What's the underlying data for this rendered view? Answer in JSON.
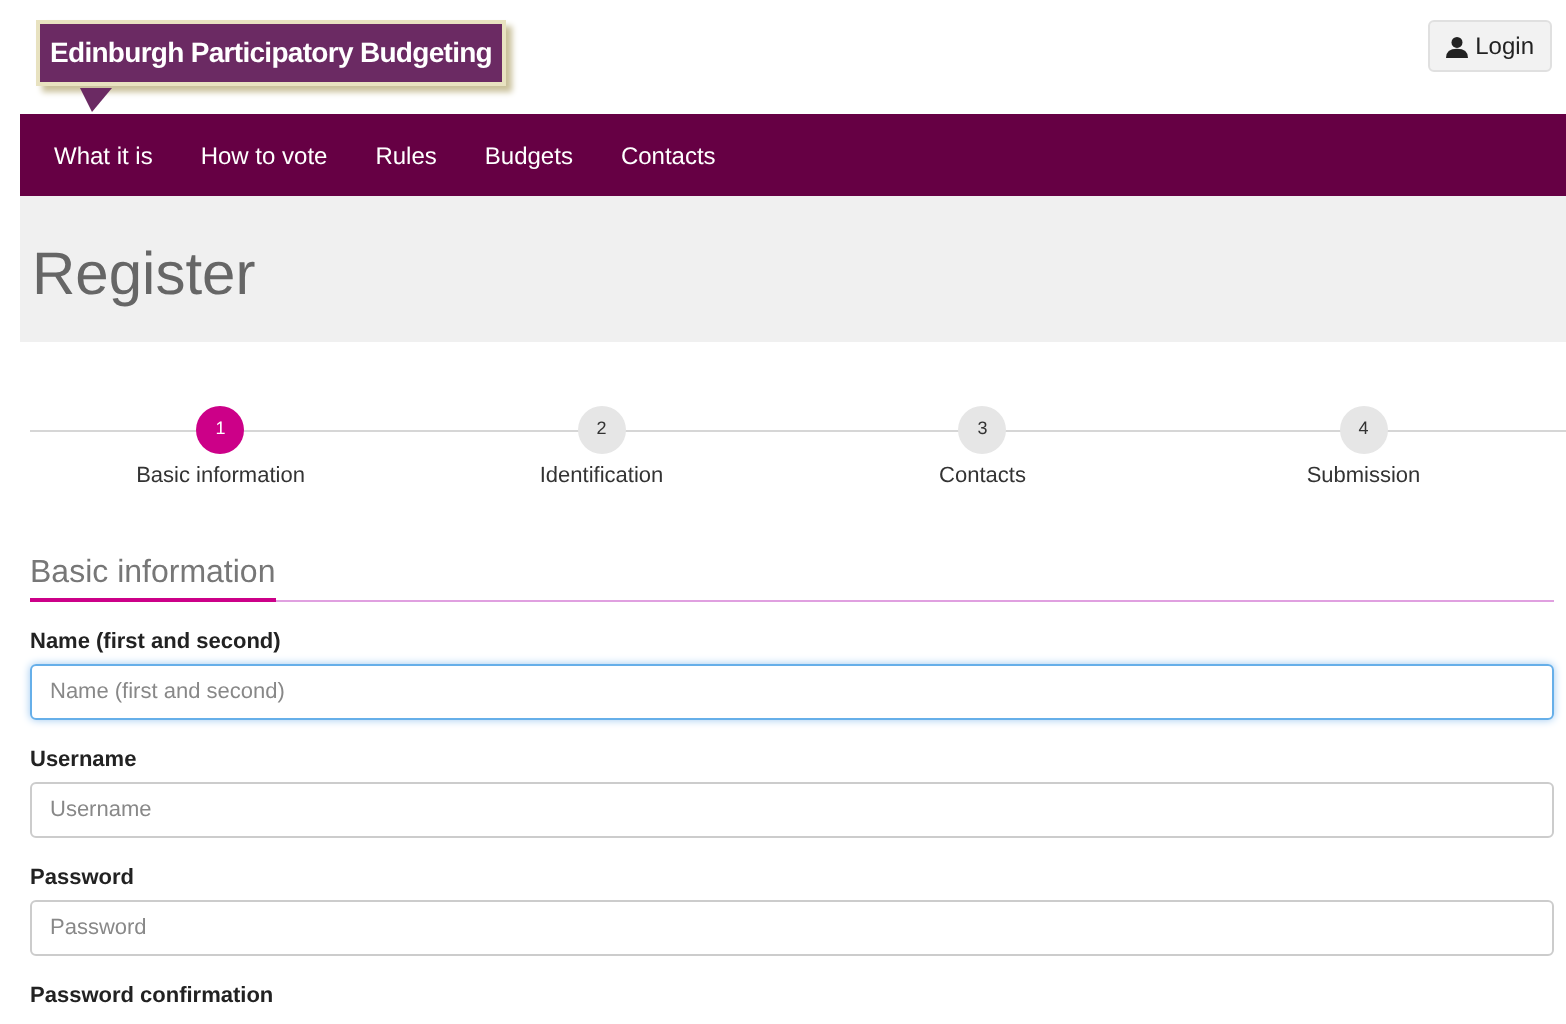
{
  "logo": {
    "text": "Edinburgh Participatory Budgeting"
  },
  "login_button": {
    "label": "Login"
  },
  "nav": {
    "items": [
      {
        "label": "What it is"
      },
      {
        "label": "How to vote"
      },
      {
        "label": "Rules"
      },
      {
        "label": "Budgets"
      },
      {
        "label": "Contacts"
      }
    ]
  },
  "page_title": "Register",
  "steps": [
    {
      "number": "1",
      "label": "Basic information",
      "selected": true
    },
    {
      "number": "2",
      "label": "Identification",
      "selected": false
    },
    {
      "number": "3",
      "label": "Contacts",
      "selected": false
    },
    {
      "number": "4",
      "label": "Submission",
      "selected": false
    }
  ],
  "section_heading": "Basic information",
  "fields": [
    {
      "label": "Name (first and second)",
      "placeholder": "Name (first and second)",
      "focused": true
    },
    {
      "label": "Username",
      "placeholder": "Username",
      "focused": false
    },
    {
      "label": "Password",
      "placeholder": "Password",
      "focused": false
    }
  ],
  "cut_label": "Password confirmation"
}
